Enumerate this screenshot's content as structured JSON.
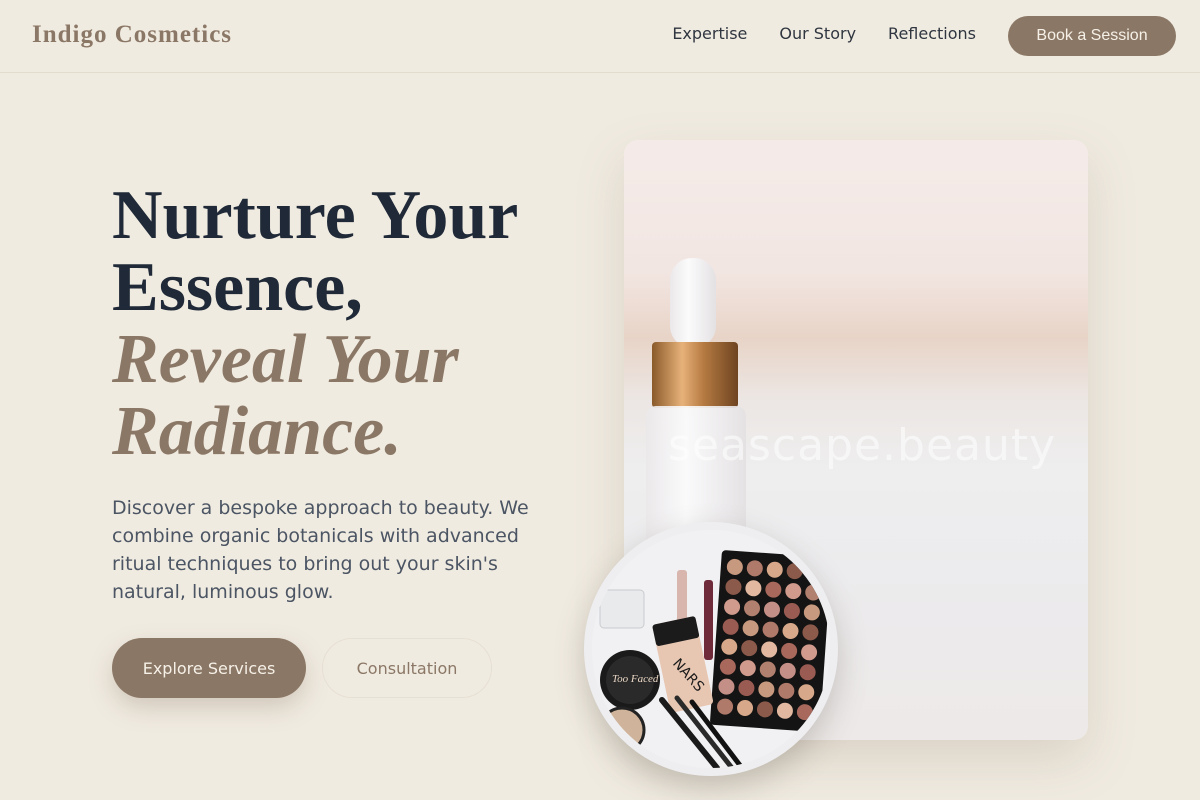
{
  "header": {
    "logo": "Indigo Cosmetics",
    "nav": [
      "Expertise",
      "Our Story",
      "Reflections"
    ],
    "cta": "Book a Session"
  },
  "hero": {
    "title_line1": "Nurture Your",
    "title_line2": "Essence,",
    "title_accent1": "Reveal Your",
    "title_accent2": "Radiance.",
    "description": "Discover a bespoke approach to beauty. We combine organic botanicals with advanced ritual techniques to bring out your skin's natural, luminous glow.",
    "primary_button": "Explore Services",
    "secondary_button": "Consultation"
  },
  "image": {
    "watermark": "seascape.beauty",
    "palette_brand": "Too Faced",
    "compact_brand": "NARS"
  },
  "colors": {
    "background": "#f0ebe1",
    "accent": "#8b7765",
    "heading": "#1f2937",
    "body_text": "#4b5563"
  }
}
